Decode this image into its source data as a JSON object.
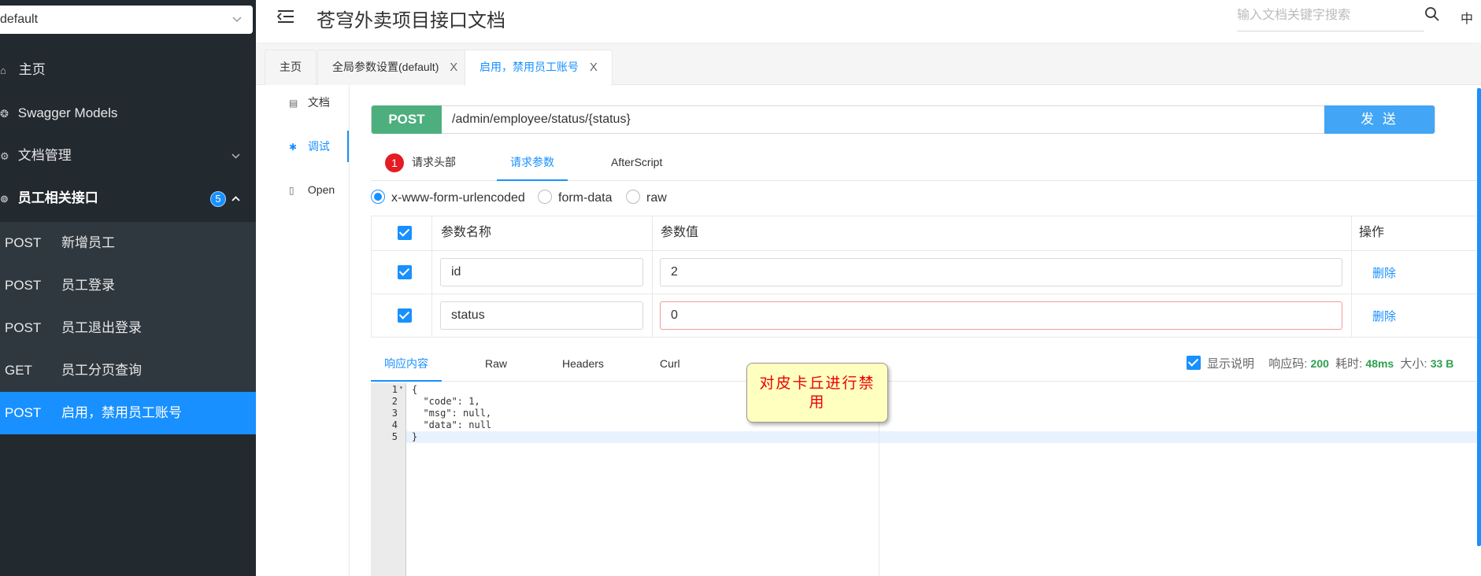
{
  "sidebar": {
    "group_select": "default",
    "menu": [
      {
        "label": "主页",
        "icon": "home-icon"
      },
      {
        "label": "Swagger Models",
        "icon": "model-icon"
      },
      {
        "label": "文档管理",
        "icon": "doc-manage-icon"
      },
      {
        "label": "员工相关接口",
        "icon": "api-group-icon",
        "badge": "5"
      }
    ],
    "sub_items": [
      {
        "method": "POST",
        "name": "新增员工"
      },
      {
        "method": "POST",
        "name": "员工登录"
      },
      {
        "method": "POST",
        "name": "员工退出登录"
      },
      {
        "method": "GET",
        "name": "员工分页查询"
      },
      {
        "method": "POST",
        "name": "启用，禁用员工账号"
      }
    ]
  },
  "header": {
    "title": "苍穹外卖项目接口文档",
    "search_placeholder": "输入文档关键字搜索",
    "lang": "中"
  },
  "tabs": [
    {
      "label": "主页"
    },
    {
      "label": "全局参数设置(default)",
      "close": "X"
    },
    {
      "label": "启用，禁用员工账号",
      "close": "X"
    }
  ],
  "doc_nav": [
    {
      "label": "文档"
    },
    {
      "label": "调试"
    },
    {
      "label": "Open"
    }
  ],
  "request": {
    "method": "POST",
    "url": "/admin/employee/status/{status}",
    "send_label": "发 送",
    "tabs": {
      "headers": "请求头部",
      "headers_badge": "1",
      "params": "请求参数",
      "afterscript": "AfterScript"
    },
    "body_types": [
      "x-www-form-urlencoded",
      "form-data",
      "raw"
    ],
    "params_table": {
      "col_name": "参数名称",
      "col_value": "参数值",
      "col_op": "操作",
      "rows": [
        {
          "name": "id",
          "value": "2",
          "delete": "删除"
        },
        {
          "name": "status",
          "value": "0",
          "delete": "删除"
        }
      ]
    }
  },
  "response": {
    "tabs": [
      "响应内容",
      "Raw",
      "Headers",
      "Curl"
    ],
    "show_desc": "显示说明",
    "code_label": "响应码:",
    "code": "200",
    "time_label": "耗时:",
    "time": "48ms",
    "size_label": "大小:",
    "size": "33 B",
    "lines": [
      "{",
      "  \"code\": 1,",
      "  \"msg\": null,",
      "  \"data\": null",
      "}"
    ]
  },
  "callout": "对皮卡丘进行禁用",
  "colors": {
    "accent": "#1890ff",
    "post": "#4caf7d",
    "sidebar": "#22292f",
    "error": "#e51c23"
  }
}
